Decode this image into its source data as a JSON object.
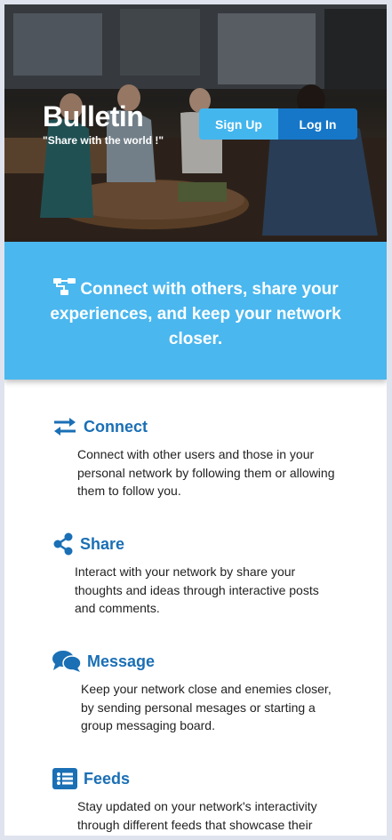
{
  "brand": {
    "name": "Bulletin",
    "tagline": "\"Share with the world !\""
  },
  "auth": {
    "signup_label": "Sign Up",
    "login_label": "Log In"
  },
  "banner": {
    "icon": "sitemap-icon",
    "text": "Connect with others, share your experiences, and keep your network closer."
  },
  "features": [
    {
      "icon": "exchange-arrows-icon",
      "title": "Connect",
      "description": "Connect with other users and those in your personal network by following them or allowing them to follow you."
    },
    {
      "icon": "share-icon",
      "title": "Share",
      "description": "Interact with your network by share your thoughts and ideas through interactive posts and comments."
    },
    {
      "icon": "chat-bubbles-icon",
      "title": "Message",
      "description": "Keep your network close and enemies closer, by sending personal mesages or starting a group messaging board."
    },
    {
      "icon": "list-icon",
      "title": "Feeds",
      "description": "Stay updated on your network's interactivity through different feeds that showcase their"
    }
  ],
  "colors": {
    "primary": "#1677c8",
    "accent": "#43b6ee",
    "banner": "#4ab7ef",
    "title": "#1a6fb5"
  }
}
